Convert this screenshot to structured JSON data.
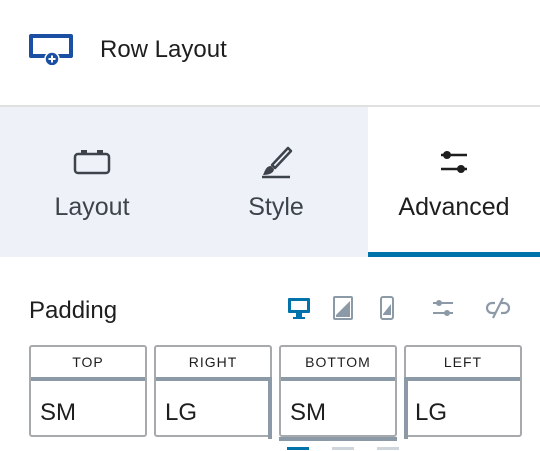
{
  "header": {
    "title": "Row Layout",
    "icon": "row-layout-icon"
  },
  "tabs": [
    {
      "label": "Layout",
      "icon": "layout-icon",
      "active": false
    },
    {
      "label": "Style",
      "icon": "brush-icon",
      "active": false
    },
    {
      "label": "Advanced",
      "icon": "sliders-icon",
      "active": true
    }
  ],
  "padding": {
    "title": "Padding",
    "devices": [
      "desktop-icon",
      "tablet-icon",
      "mobile-icon",
      "sliders-icon",
      "unlink-icon"
    ],
    "fields": [
      {
        "label": "TOP",
        "value": "SM"
      },
      {
        "label": "RIGHT",
        "value": "LG"
      },
      {
        "label": "BOTTOM",
        "value": "SM"
      },
      {
        "label": "LEFT",
        "value": "LG"
      }
    ]
  },
  "colors": {
    "accent": "#0073aa",
    "tab_bg": "#eef2f8"
  }
}
